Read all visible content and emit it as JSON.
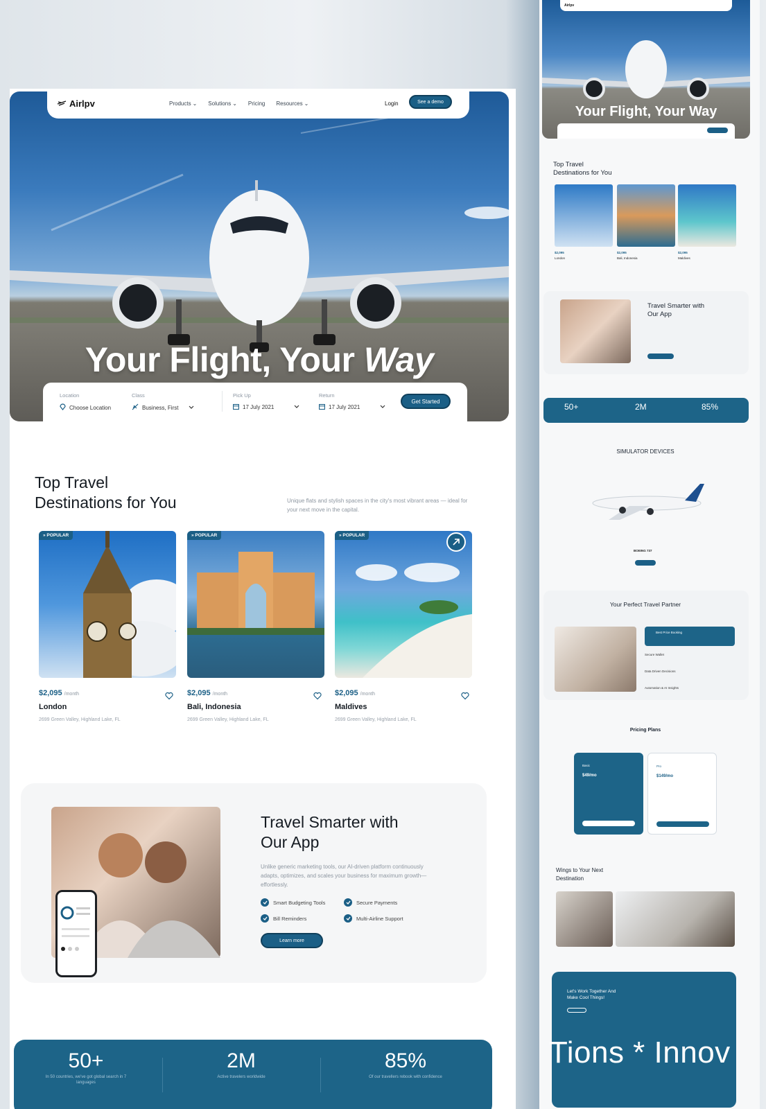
{
  "brand": {
    "name": "Airlpv",
    "accent": "#1b5f86",
    "accent_dark": "#1d6488"
  },
  "nav": {
    "links": [
      "Products",
      "Solutions",
      "Pricing",
      "Resources"
    ],
    "login": "Login",
    "cta": "See a demo"
  },
  "hero": {
    "title_main": "Your Flight, Your ",
    "title_italic": "Way"
  },
  "search": {
    "location_label": "Location",
    "location_value": "Choose Location",
    "class_label": "Class",
    "class_value": "Business, First",
    "pickup_label": "Pick Up",
    "pickup_value": "17 July 2021",
    "return_label": "Return",
    "return_value": "17 July 2021",
    "button": "Get Started"
  },
  "destinations": {
    "title_line1": "Top Travel",
    "title_line2": "Destinations for You",
    "description": "Unique flats and stylish spaces in the city's most vibrant areas — ideal for your next move in the capital.",
    "cards": [
      {
        "badge": "POPULAR",
        "price": "$2,095",
        "period": "/month",
        "name": "London",
        "address": "2699 Green Valley, Highland Lake, FL"
      },
      {
        "badge": "POPULAR",
        "price": "$2,095",
        "period": "/month",
        "name": "Bali, Indonesia",
        "address": "2699 Green Valley, Highland Lake, FL"
      },
      {
        "badge": "POPULAR",
        "price": "$2,095",
        "period": "/month",
        "name": "Maldives",
        "address": "2699 Green Valley, Highland Lake, FL"
      }
    ]
  },
  "app": {
    "title_line1": "Travel Smarter with",
    "title_line2": "Our App",
    "description": "Unlike generic marketing tools, our AI-driven platform continuously adapts, optimizes, and scales your business for maximum growth—effortlessly.",
    "features": [
      "Smart Budgeting Tools",
      "Secure Payments",
      "Bill Reminders",
      "Multi-Airline Support"
    ],
    "button": "Learn more"
  },
  "stats": [
    {
      "value": "50+",
      "text": "In 50 countries, we've got global search in 7 languages"
    },
    {
      "value": "2M",
      "text": "Active travelers worldwide"
    },
    {
      "value": "85%",
      "text": "Of our travellers rebook with confidence"
    }
  ],
  "side": {
    "hero_title": "Your Flight, Your Way",
    "dest_title_line1": "Top Travel",
    "dest_title_line2": "Destinations for You",
    "card_names": [
      "London",
      "Bali, Indonesia",
      "Maldives"
    ],
    "card_price": "$2,095",
    "app_title_line1": "Travel Smarter with",
    "app_title_line2": "Our App",
    "stats": [
      "50+",
      "2M",
      "85%"
    ],
    "simulator_title": "SIMULATOR DEVICES",
    "simulator_model": "BOEING 737",
    "partner_title": "Your Perfect Travel Partner",
    "partner_items": [
      "Best Price Booking",
      "Secure Wallet",
      "Data Driven Decisions",
      "Automation & AI Insights"
    ],
    "pricing_title": "Pricing Plans",
    "plans": [
      {
        "name": "Basic",
        "price": "$49/mo"
      },
      {
        "name": "Pro",
        "price": "$149/mo"
      }
    ],
    "wings_title_line1": "Wings to Your Next",
    "wings_title_line2": "Destination",
    "footer_title_line1": "Let's Work Together And",
    "footer_title_line2": "Make Cool Things!",
    "ticker": "Tions * Innov"
  }
}
